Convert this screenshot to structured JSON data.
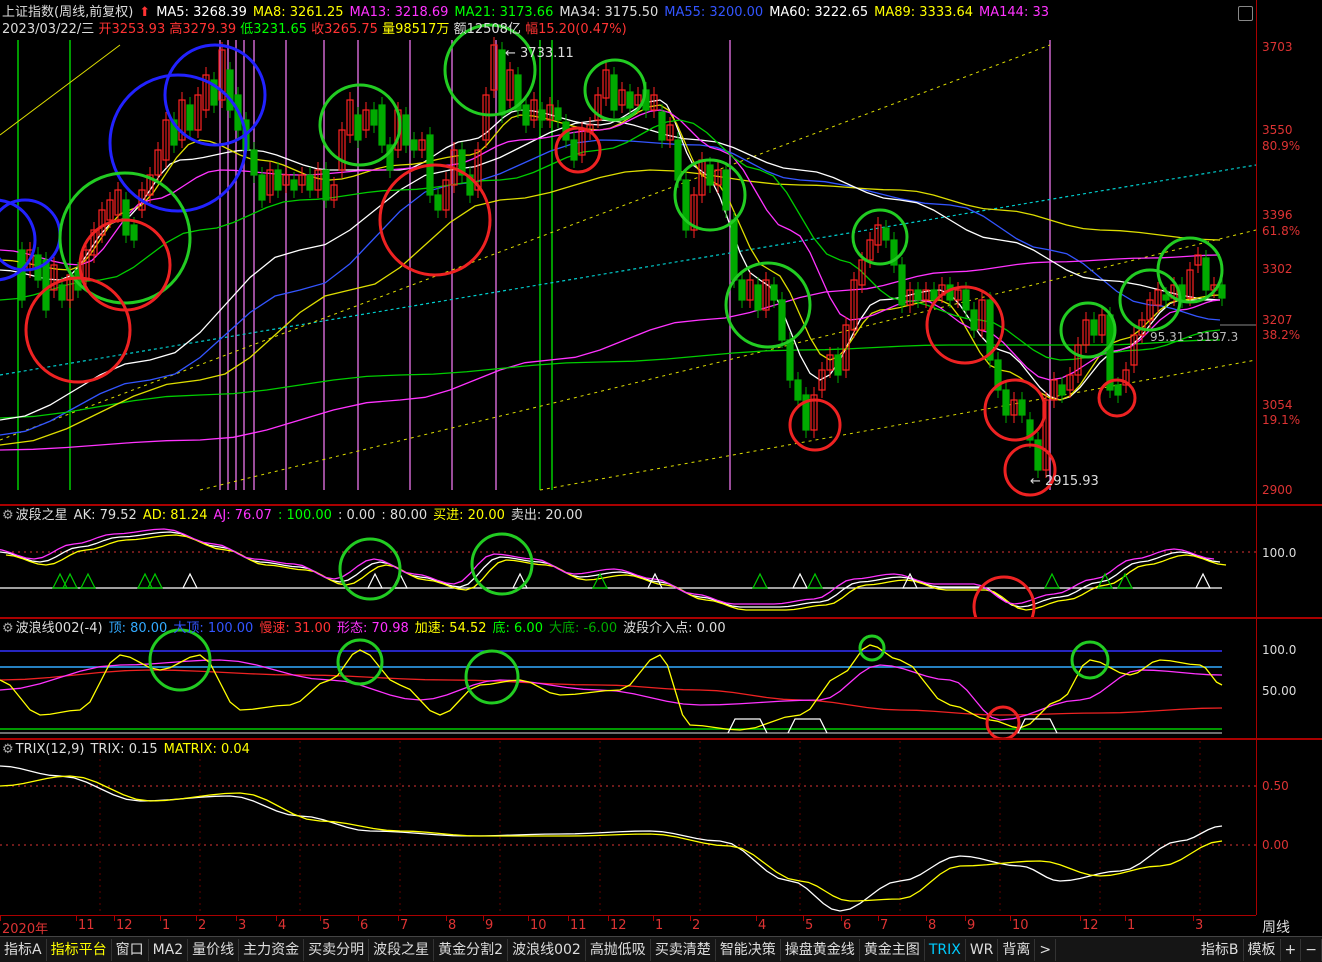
{
  "main": {
    "title": "上证指数(周线,前复权)",
    "ma": [
      {
        "label": "MA5: 3268.39",
        "color": "#ffffff"
      },
      {
        "label": "MA8: 3261.25",
        "color": "#ffff00"
      },
      {
        "label": "MA13: 3218.69",
        "color": "#ff33ff"
      },
      {
        "label": "MA21: 3173.66",
        "color": "#00ff00"
      },
      {
        "label": "MA34: 3175.50",
        "color": "#dddddd"
      },
      {
        "label": "MA55: 3200.00",
        "color": "#3355ff"
      },
      {
        "label": "MA60: 3222.65",
        "color": "#ffffff"
      },
      {
        "label": "MA89: 3333.64",
        "color": "#ffff00"
      },
      {
        "label": "MA144: 33",
        "color": "#ff33ff"
      }
    ],
    "info": {
      "date": "2023/03/22/三",
      "open": "开3253.93",
      "high": "高3279.39",
      "low": "低3231.65",
      "close": "收3265.75",
      "vol": "量98517万",
      "amount": "额12508亿",
      "range": "幅15.20(0.47%)"
    },
    "annotations": {
      "peak": "3733.11",
      "trough": "2915.93",
      "right_val": "95.31 - 3197.3"
    },
    "y_axis": [
      "3703",
      "3550",
      "80.9%",
      "3396",
      "61.8%",
      "3302",
      "3207",
      "38.2%",
      "3054",
      "19.1%",
      "2900"
    ]
  },
  "p1": {
    "title": "波段之星",
    "items": [
      {
        "label": "AK: 79.52",
        "color": "#dddddd"
      },
      {
        "label": "AD: 81.24",
        "color": "#ffff00"
      },
      {
        "label": "AJ: 76.07",
        "color": "#ff33ff"
      },
      {
        "label": ": 100.00",
        "color": "#00ff00"
      },
      {
        "label": ": 0.00",
        "color": "#dddddd"
      },
      {
        "label": ": 80.00",
        "color": "#dddddd"
      },
      {
        "label": "买进: 20.00",
        "color": "#ffff00"
      },
      {
        "label": "卖出: 20.00",
        "color": "#dddddd"
      }
    ],
    "y_axis": [
      "100.0"
    ]
  },
  "p2": {
    "title": "波浪线002(-4)",
    "items": [
      {
        "label": "顶: 80.00",
        "color": "#33aaff"
      },
      {
        "label": "大顶: 100.00",
        "color": "#3355ff"
      },
      {
        "label": "慢速: 31.00",
        "color": "#ff3333"
      },
      {
        "label": "形态: 70.98",
        "color": "#ff33ff"
      },
      {
        "label": "加速: 54.52",
        "color": "#ffff00"
      },
      {
        "label": "底: 6.00",
        "color": "#00ff00"
      },
      {
        "label": "大底: -6.00",
        "color": "#00aa00"
      },
      {
        "label": "波段介入点: 0.00",
        "color": "#dddddd"
      }
    ],
    "y_axis": [
      "100.0",
      "50.00"
    ]
  },
  "p3": {
    "title": "TRIX(12,9)",
    "items": [
      {
        "label": "TRIX: 0.15",
        "color": "#dddddd"
      },
      {
        "label": "MATRIX: 0.04",
        "color": "#ffff00"
      }
    ],
    "y_axis": [
      "0.50",
      "0.00"
    ]
  },
  "time_axis": {
    "labels": [
      "2020年",
      "11",
      "12",
      "1",
      "2",
      "3",
      "4",
      "5",
      "6",
      "7",
      "8",
      "9",
      "10",
      "11",
      "12",
      "1",
      "2",
      "4",
      "5",
      "6",
      "7",
      "8",
      "9",
      "10",
      "12",
      "1",
      "3"
    ],
    "period": "周线"
  },
  "tabs": [
    "指标A",
    "指标平台",
    "窗口",
    "MA2",
    "量价线",
    "主力资金",
    "买卖分明",
    "波段之星",
    "黄金分割2",
    "波浪线002",
    "高抛低吸",
    "买卖清楚",
    "智能决策",
    "操盘黄金线",
    "黄金主图",
    "TRIX",
    "WR",
    "背离",
    ">"
  ],
  "right_tabs": [
    "指标B",
    "模板",
    "+",
    "−"
  ]
}
